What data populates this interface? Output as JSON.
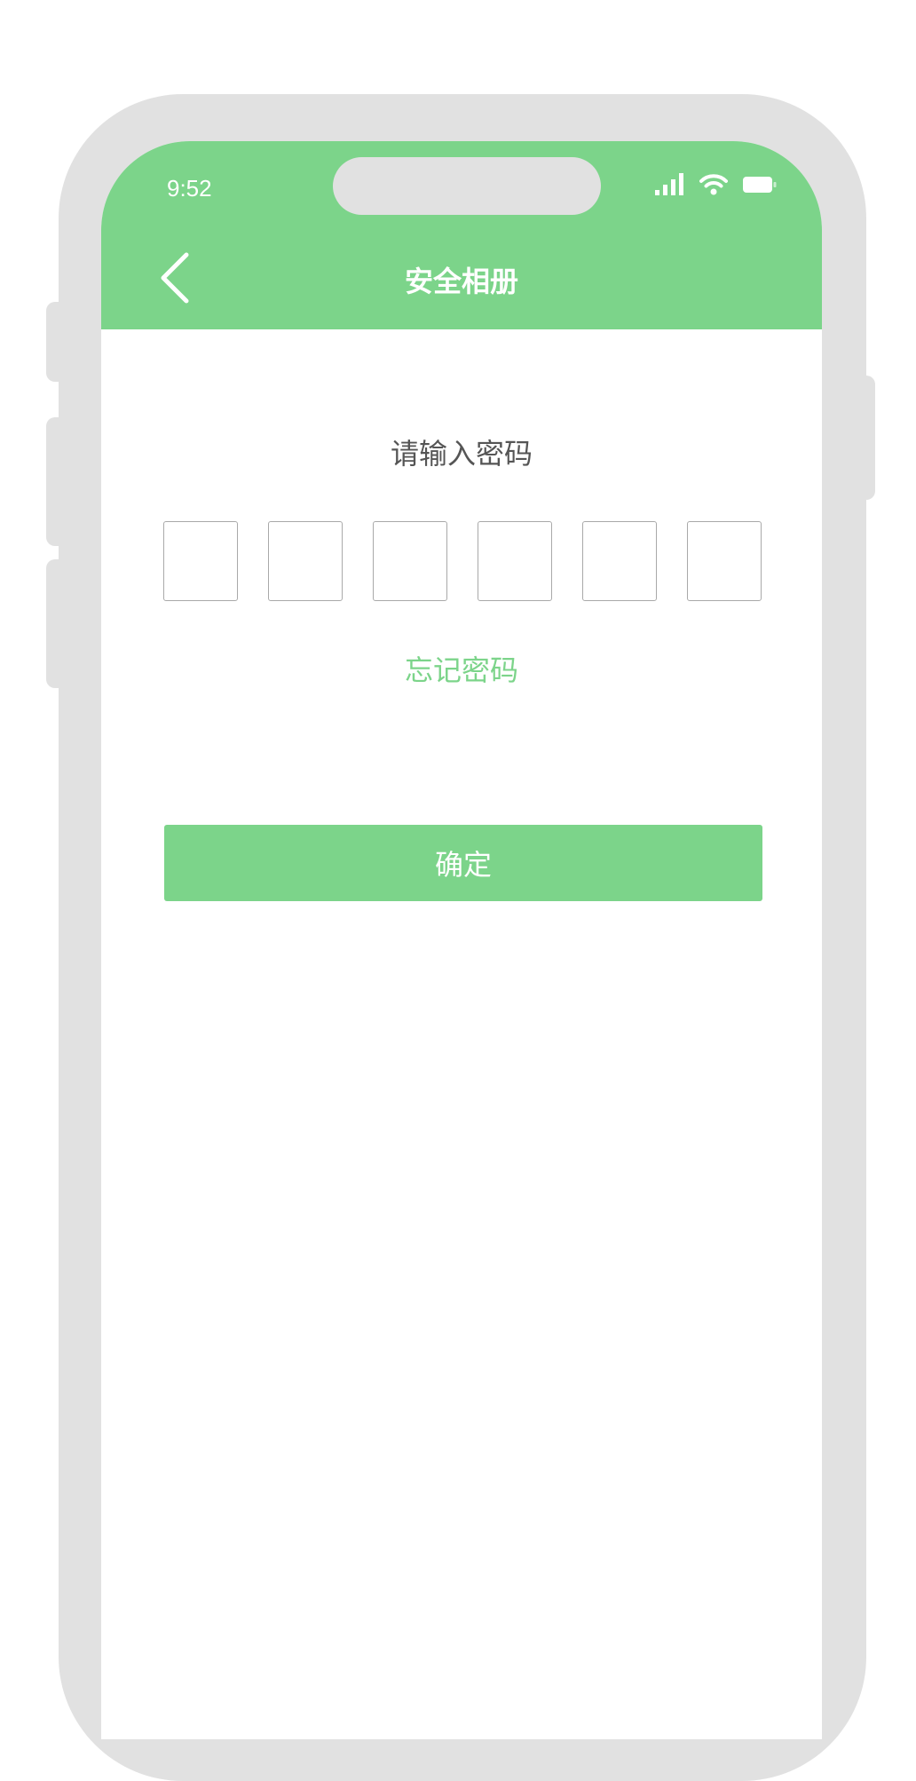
{
  "status_bar": {
    "time": "9:52",
    "icons": [
      "cellular-signal-icon",
      "wifi-icon",
      "battery-icon"
    ]
  },
  "nav": {
    "back_icon": "chevron-left-icon",
    "title": "安全相册"
  },
  "password": {
    "prompt": "请输入密码",
    "digits": [
      "",
      "",
      "",
      "",
      "",
      ""
    ]
  },
  "forgot_password": "忘记密码",
  "confirm_label": "确定",
  "colors": {
    "accent": "#7cd48a",
    "frame": "#e1e1e1",
    "prompt_text": "#555555",
    "box_border": "#a9a9a9"
  }
}
